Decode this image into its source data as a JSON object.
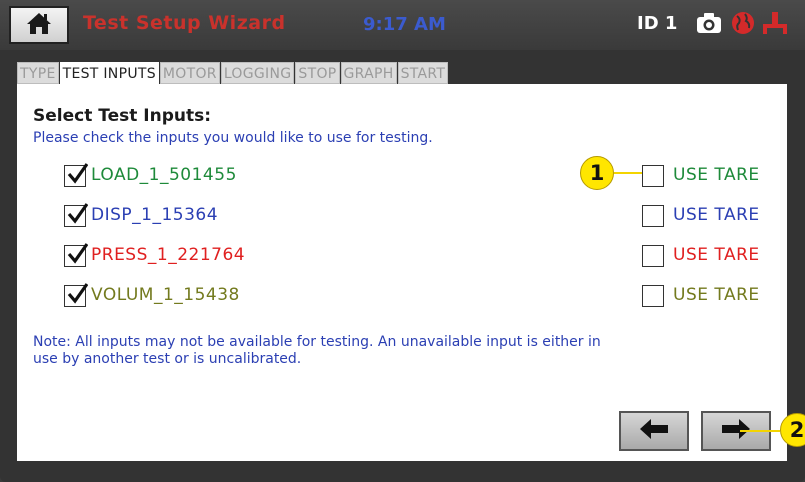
{
  "header": {
    "title": "Test Setup Wizard",
    "time": "9:17 AM",
    "device_id": "ID 1",
    "icons": [
      "home-icon",
      "camera-icon",
      "globe-icon",
      "network-icon"
    ]
  },
  "tabs": [
    {
      "label": "TYPE",
      "active": false
    },
    {
      "label": "TEST INPUTS",
      "active": true
    },
    {
      "label": "MOTOR",
      "active": false
    },
    {
      "label": "LOGGING",
      "active": false
    },
    {
      "label": "STOP",
      "active": false
    },
    {
      "label": "GRAPH",
      "active": false
    },
    {
      "label": "START",
      "active": false
    }
  ],
  "main": {
    "heading": "Select Test Inputs:",
    "instructions": "Please check the inputs you would like to use for testing.",
    "inputs": [
      {
        "name": "LOAD_1_501455",
        "checked": true,
        "tare_label": "USE TARE",
        "tare_checked": false,
        "color": "#1e8a3a"
      },
      {
        "name": "DISP_1_15364",
        "checked": true,
        "tare_label": "USE TARE",
        "tare_checked": false,
        "color": "#2b3fb3"
      },
      {
        "name": "PRESS_1_221764",
        "checked": true,
        "tare_label": "USE TARE",
        "tare_checked": false,
        "color": "#e02020"
      },
      {
        "name": "VOLUM_1_15438",
        "checked": true,
        "tare_label": "USE TARE",
        "tare_checked": false,
        "color": "#737a1e"
      }
    ],
    "note_line1": "Note:  All inputs may not be available for testing.  An unavailable input is either in",
    "note_line2": "use by another test or is uncalibrated."
  },
  "callouts": [
    "1",
    "2"
  ],
  "colors": {
    "accent_red": "#c9322c",
    "time_blue": "#3b5bcf",
    "callout": "#ffe600"
  }
}
